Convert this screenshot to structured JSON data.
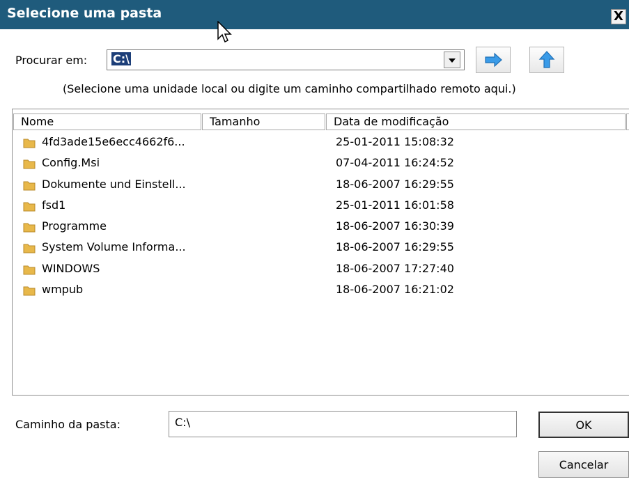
{
  "window": {
    "title": "Selecione uma pasta",
    "close_label": "X"
  },
  "location": {
    "label": "Procurar em:",
    "value": "C:\\",
    "hint": "(Selecione uma unidade local ou digite um caminho compartilhado remoto aqui.)"
  },
  "columns": {
    "name": "Nome",
    "size": "Tamanho",
    "modified": "Data de modificação"
  },
  "rows": [
    {
      "name": "4fd3ade15e6ecc4662f6...",
      "modified": "25-01-2011 15:08:32"
    },
    {
      "name": "Config.Msi",
      "modified": "07-04-2011 16:24:52"
    },
    {
      "name": "Dokumente und Einstell...",
      "modified": "18-06-2007 16:29:55"
    },
    {
      "name": "fsd1",
      "modified": "25-01-2011 16:01:58"
    },
    {
      "name": "Programme",
      "modified": "18-06-2007 16:30:39"
    },
    {
      "name": "System Volume Informa...",
      "modified": "18-06-2007 16:29:55"
    },
    {
      "name": "WINDOWS",
      "modified": "18-06-2007 17:27:40"
    },
    {
      "name": "wmpub",
      "modified": "18-06-2007 16:21:02"
    }
  ],
  "path": {
    "label": "Caminho da pasta:",
    "value": "C:\\"
  },
  "buttons": {
    "ok": "OK",
    "cancel": "Cancelar"
  },
  "icons": {
    "go": "arrow-right-icon",
    "up": "arrow-up-icon",
    "folder": "folder-icon"
  },
  "colors": {
    "titlebar": "#1f5b7c",
    "selection": "#1c3e78",
    "folder": "#e8b84a",
    "arrow": "#3a9be8"
  }
}
